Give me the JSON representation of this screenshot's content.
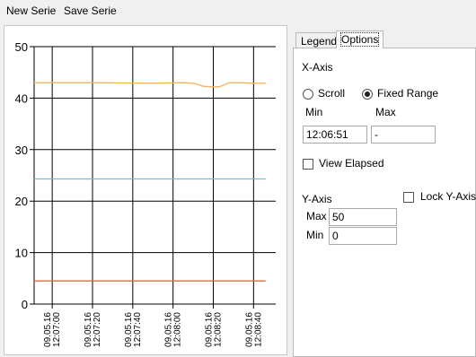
{
  "menu": {
    "new_serie": "New Serie",
    "save_serie": "Save Serie"
  },
  "tabs": {
    "legend": "Legend",
    "options": "Options"
  },
  "options": {
    "x_axis_label": "X-Axis",
    "scroll_label": "Scroll",
    "fixed_range_label": "Fixed Range",
    "fixed_range_selected": true,
    "min_label": "Min",
    "max_label": "Max",
    "x_min_value": "12:06:51",
    "x_max_value": "-",
    "view_elapsed_label": "View Elapsed",
    "view_elapsed_checked": false,
    "y_axis_label": "Y-Axis",
    "lock_y_axis_label": "Lock Y-Axis",
    "lock_y_axis_checked": false,
    "y_max_label": "Max",
    "y_max_value": "50",
    "y_min_label": "Min",
    "y_min_value": "0"
  },
  "chart_data": {
    "type": "line",
    "title": "",
    "xlabel": "",
    "ylabel": "",
    "ylim": [
      0,
      50
    ],
    "y_ticks": [
      0,
      10,
      20,
      30,
      40,
      50
    ],
    "x_tick_labels": [
      [
        "09.05.16",
        "12:07:00"
      ],
      [
        "09.05.16",
        "12:07:20"
      ],
      [
        "09.05.16",
        "12:07:40"
      ],
      [
        "09.05.16",
        "12:08:00"
      ],
      [
        "09.05.16",
        "12:08:20"
      ],
      [
        "09.05.16",
        "12:08:40"
      ]
    ],
    "x_tick_seconds": [
      9,
      29,
      49,
      69,
      89,
      109
    ],
    "xlim_seconds": [
      0,
      120
    ],
    "grid": true,
    "series": [
      {
        "color": "#f5b461",
        "x": [
          0,
          30,
          60,
          75,
          80,
          84,
          88,
          92,
          97,
          102,
          110,
          115
        ],
        "y": [
          43.0,
          43.0,
          42.9,
          43.0,
          42.8,
          42.3,
          42.2,
          42.2,
          43.0,
          43.0,
          42.9,
          42.9
        ]
      },
      {
        "color": "#7fb9d8",
        "x": [
          0,
          115
        ],
        "y": [
          24.3,
          24.3
        ]
      },
      {
        "color": "#e8663c",
        "x": [
          0,
          115
        ],
        "y": [
          4.5,
          4.5
        ]
      }
    ]
  },
  "colors": {
    "window_bg": "#f0f0f0",
    "plot_bg": "#ffffff",
    "grid": "#000000"
  }
}
